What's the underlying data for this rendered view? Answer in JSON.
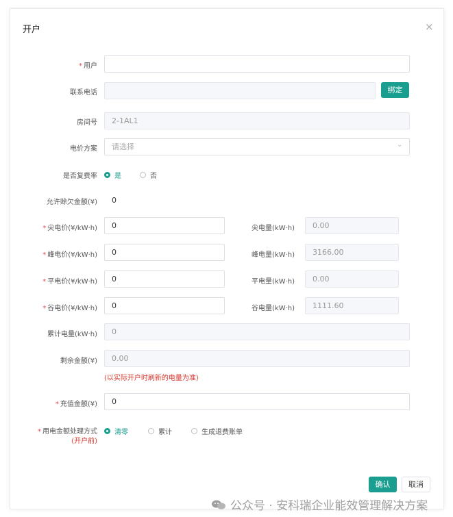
{
  "dialog": {
    "title": "开户",
    "close": "×"
  },
  "fields": {
    "user": {
      "label": "用户",
      "value": ""
    },
    "phone": {
      "label": "联系电话",
      "value": "",
      "button": "绑定"
    },
    "room": {
      "label": "房间号",
      "value": "2-1AL1"
    },
    "price_plan": {
      "label": "电价方案",
      "placeholder": "请选择"
    },
    "multi_rate": {
      "label": "是否复费率",
      "options": [
        "是",
        "否"
      ],
      "selected": "是"
    },
    "allowed_arrears": {
      "label": "允许赊欠金额(¥)",
      "value": "0"
    },
    "sharp_price": {
      "label": "尖电价(¥/kW·h)",
      "value": "0"
    },
    "peak_price": {
      "label": "峰电价(¥/kW·h)",
      "value": "0"
    },
    "flat_price": {
      "label": "平电价(¥/kW·h)",
      "value": "0"
    },
    "valley_price": {
      "label": "谷电价(¥/kW·h)",
      "value": "0"
    },
    "sharp_energy": {
      "label": "尖电量(kW·h)",
      "value": "0.00"
    },
    "peak_energy": {
      "label": "峰电量(kW·h)",
      "value": "3166.00"
    },
    "flat_energy": {
      "label": "平电量(kW·h)",
      "value": "0.00"
    },
    "valley_energy": {
      "label": "谷电量(kW·h)",
      "value": "1111.60"
    },
    "total_energy": {
      "label": "累计电量(kW·h)",
      "value": "0"
    },
    "remaining_amount": {
      "label": "剩余金额(¥)",
      "value": "0.00",
      "hint": "(以实际开户时刷新的电量为准)"
    },
    "recharge_amount": {
      "label": "充值金额(¥)",
      "value": "0"
    },
    "mode": {
      "label": "用电金额处理方式",
      "sub_label": "(开户前)",
      "options": [
        "清零",
        "累计",
        "生成退费账单"
      ],
      "selected": "清零"
    }
  },
  "footer": {
    "confirm": "确认",
    "cancel": "取消"
  },
  "watermark": "公众号 · 安科瑞企业能效管理解决方案",
  "colors": {
    "accent": "#1a9e8f",
    "required": "#e0484f",
    "hint": "#d9362b"
  }
}
